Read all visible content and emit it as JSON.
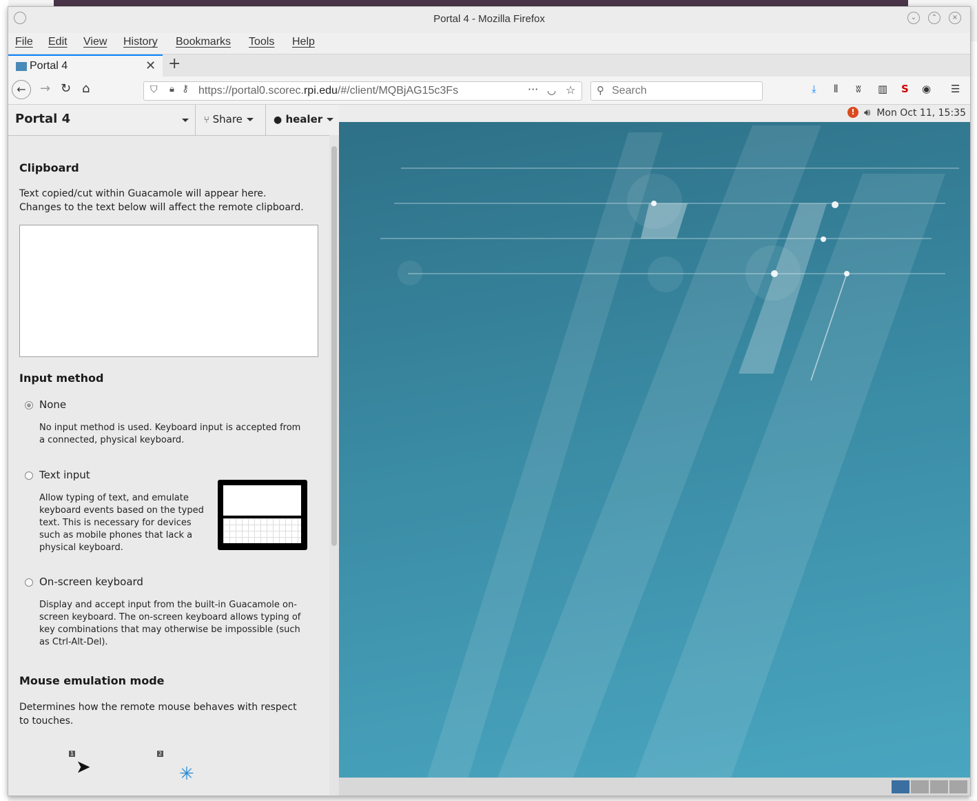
{
  "window": {
    "title": "Portal 4 - Mozilla Firefox",
    "controls": [
      "minimize",
      "maximize",
      "close"
    ]
  },
  "menu": [
    "File",
    "Edit",
    "View",
    "History",
    "Bookmarks",
    "Tools",
    "Help"
  ],
  "tab": {
    "label": "Portal 4"
  },
  "navbar": {
    "url_prefix": "https://portal0.scorec.",
    "url_domain": "rpi.edu",
    "url_suffix": "/#/client/MQBjAG15c3Fs",
    "search_placeholder": "Search"
  },
  "guac_panel": {
    "title": "Portal 4",
    "share_label": "Share",
    "user_label": "healer",
    "clipboard": {
      "heading": "Clipboard",
      "description": "Text copied/cut within Guacamole will appear here. Changes to the text below will affect the remote clipboard.",
      "value": ""
    },
    "input_method": {
      "heading": "Input method",
      "options": [
        {
          "label": "None",
          "desc": "No input method is used. Keyboard input is accepted from a connected, physical keyboard.",
          "selected": true
        },
        {
          "label": "Text input",
          "desc": "Allow typing of text, and emulate keyboard events based on the typed text. This is necessary for devices such as mobile phones that lack a physical keyboard.",
          "selected": false
        },
        {
          "label": "On-screen keyboard",
          "desc": "Display and accept input from the built-in Guacamole on-screen keyboard. The on-screen keyboard allows typing of key combinations that may otherwise be impossible (such as Ctrl-Alt-Del).",
          "selected": false
        }
      ]
    },
    "mouse_mode": {
      "heading": "Mouse emulation mode",
      "description": "Determines how the remote mouse behaves with respect to touches.",
      "step1": "1",
      "step2": "2"
    }
  },
  "remote_desktop": {
    "clock": "Mon Oct 11, 15:35",
    "workspaces": 4,
    "active_workspace": 1
  }
}
